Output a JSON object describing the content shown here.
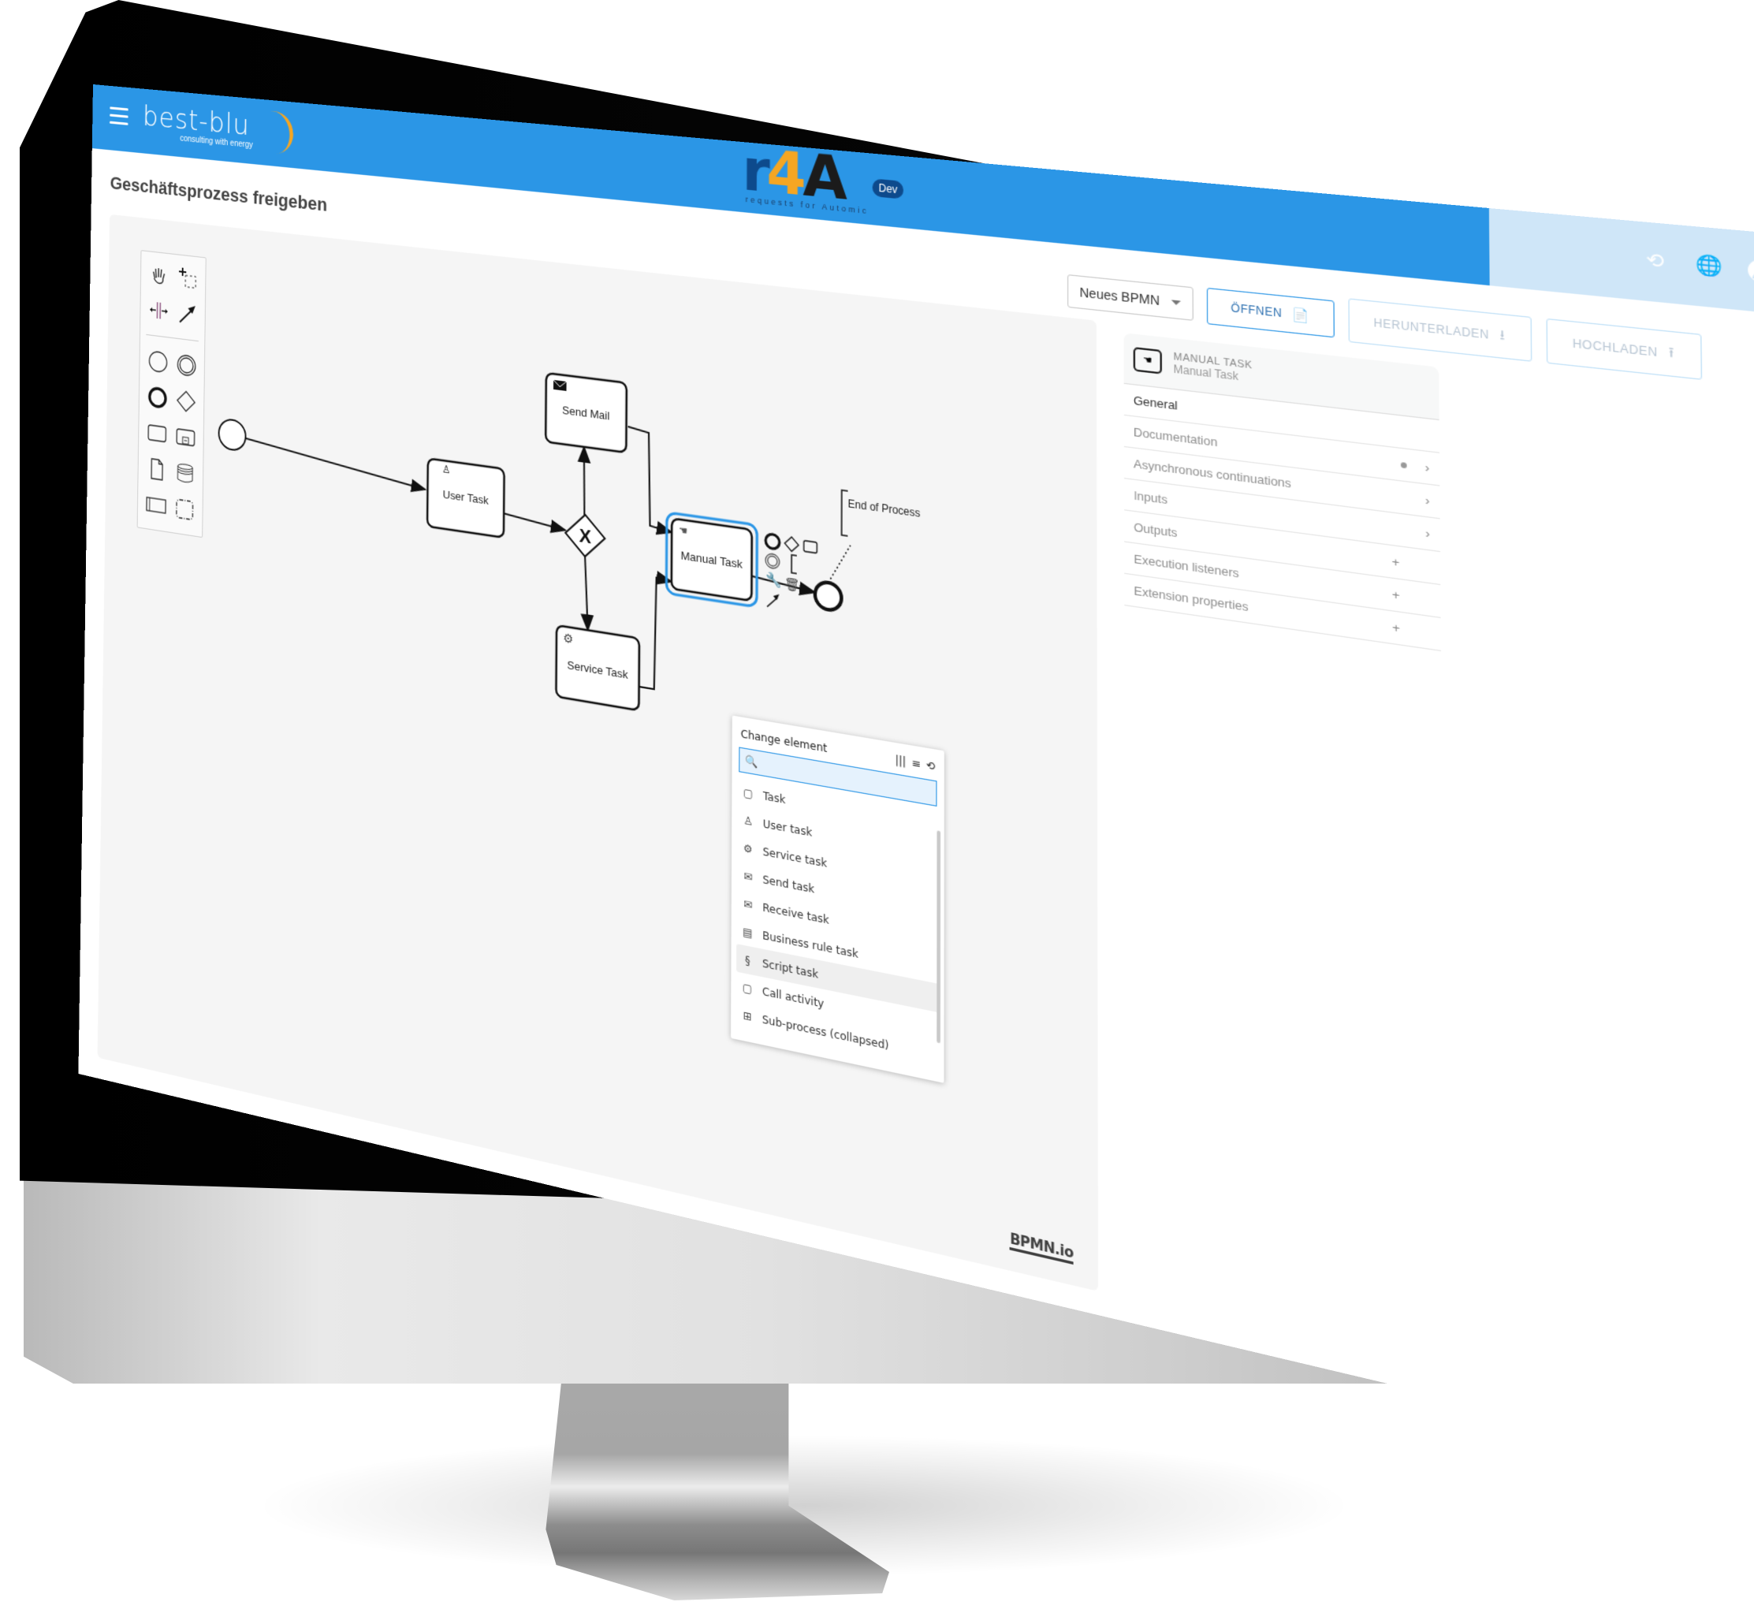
{
  "app": {
    "brand": "best-blu",
    "brand_tagline": "consulting with energy",
    "product_letters": [
      "r",
      "4",
      "A"
    ],
    "product_subtitle": "requests for Automic",
    "env_badge": "Dev",
    "colors": {
      "header_blue": "#2b96e6",
      "header_tint": "#cfe6f8",
      "brand_navy": "#0d4a8c",
      "brand_orange": "#f5a623",
      "selection_blue": "#2b96e6"
    },
    "header_icons": [
      {
        "name": "history-settings-icon",
        "glyph": "⟲"
      },
      {
        "name": "globe-icon",
        "glyph": "🌐"
      },
      {
        "name": "account-icon",
        "glyph": ""
      }
    ]
  },
  "page": {
    "title": "Geschäftsprozess freigeben"
  },
  "toolbar": {
    "select_value": "Neues BPMN",
    "open_label": "ÖFFNEN",
    "download_label": "HERUNTERLADEN",
    "upload_label": "HOCHLADEN",
    "open_icon": "📄",
    "download_icon": "⭳",
    "upload_icon": "⭱"
  },
  "palette": {
    "tools": [
      "hand-tool",
      "lasso-tool",
      "space-tool",
      "global-connect-tool",
      "start-event",
      "intermediate-event",
      "end-event",
      "exclusive-gateway",
      "task",
      "subprocess",
      "data-object",
      "data-store",
      "pool",
      "group"
    ]
  },
  "diagram": {
    "nodes": {
      "start": "",
      "user_task": "User Task",
      "gateway": "X",
      "send_mail": "Send Mail",
      "service_task": "Service Task",
      "manual_task": "Manual Task",
      "end": "",
      "annotation": "End of Process"
    },
    "watermark": "BPMN.io"
  },
  "change_element": {
    "title": "Change element",
    "header_icons": [
      "|||",
      "≡",
      "⟲"
    ],
    "search_placeholder": "",
    "search_value": "",
    "items": [
      {
        "label": "Task",
        "icon": "▢"
      },
      {
        "label": "User task",
        "icon": "♙"
      },
      {
        "label": "Service task",
        "icon": "⚙"
      },
      {
        "label": "Send task",
        "icon": "✉"
      },
      {
        "label": "Receive task",
        "icon": "✉"
      },
      {
        "label": "Business rule task",
        "icon": "▤"
      },
      {
        "label": "Script task",
        "icon": "§"
      },
      {
        "label": "Call activity",
        "icon": "▢"
      },
      {
        "label": "Sub-process (collapsed)",
        "icon": "⊞"
      }
    ],
    "highlighted_index": 6
  },
  "properties": {
    "element_type": "MANUAL TASK",
    "element_name": "Manual Task",
    "groups": [
      {
        "label": "General",
        "indicator": "",
        "active": true
      },
      {
        "label": "Documentation",
        "indicator": "dot-chevron"
      },
      {
        "label": "Asynchronous continuations",
        "indicator": "chevron"
      },
      {
        "label": "Inputs",
        "indicator": "chevron"
      },
      {
        "label": "Outputs",
        "indicator": "plus"
      },
      {
        "label": "Execution listeners",
        "indicator": "plus"
      },
      {
        "label": "Extension properties",
        "indicator": "plus"
      }
    ],
    "chevron": "›",
    "plus": "+"
  }
}
